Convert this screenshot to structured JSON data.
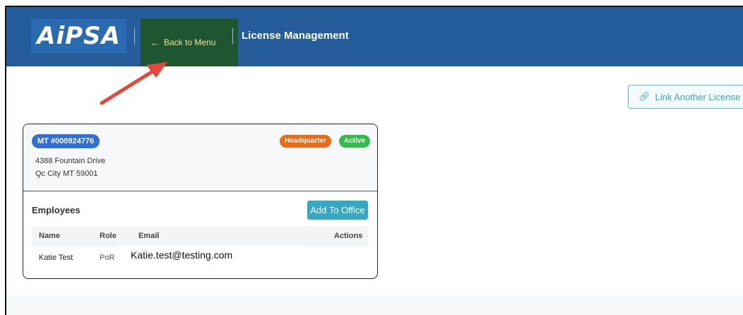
{
  "header": {
    "logo_text": "AiPSA",
    "back_label": "Back to Menu",
    "back_icon": "arrow-left-icon",
    "title": "License Management",
    "bg_color": "#245c9c"
  },
  "actions": {
    "link_label": "Link Another License",
    "link_icon": "link-icon"
  },
  "office": {
    "license_badge": "MT #000924776",
    "hq_badge": "Headquarter",
    "status_badge": "Active",
    "address_line1": "4388 Fountain Drive",
    "address_line2": "Qc City MT 59001"
  },
  "employees": {
    "title": "Employees",
    "add_label": "Add To Office",
    "columns": [
      "Name",
      "Role",
      "Email",
      "Actions"
    ],
    "rows": [
      {
        "name": "Katie Test",
        "role": "PoR",
        "email": "Katie.test@testing.com"
      }
    ]
  },
  "annotation": {
    "arrow_color": "#e8463a"
  }
}
